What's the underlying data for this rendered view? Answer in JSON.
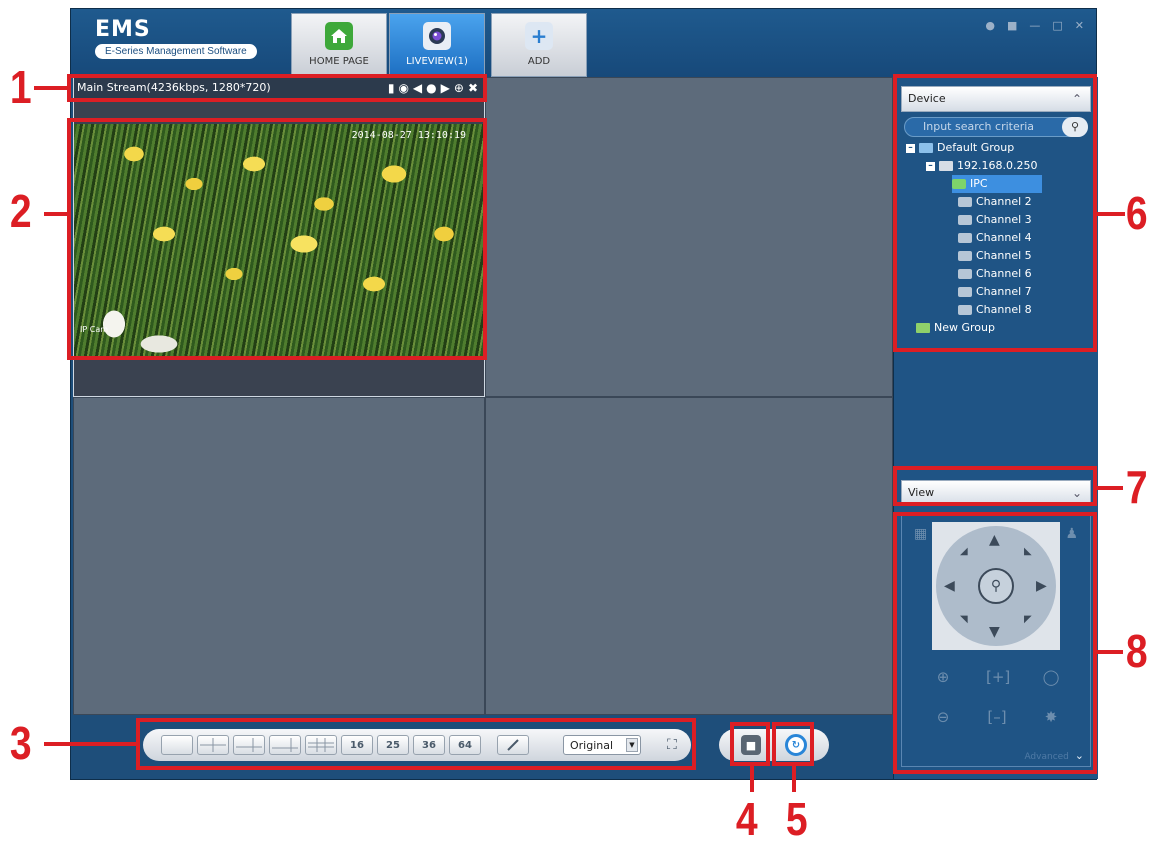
{
  "app": {
    "logo_title": "EMS",
    "logo_subtitle": "E-Series Management Software"
  },
  "tabs": [
    {
      "label": "HOME PAGE",
      "icon": "home-icon"
    },
    {
      "label": "LIVEVIEW(1)",
      "icon": "camera-lens-icon",
      "active": true
    },
    {
      "label": "ADD",
      "icon": "plus-icon"
    }
  ],
  "stream": {
    "info": "Main Stream(4236kbps, 1280*720)",
    "timestamp": "2014-08-27 13:10:19",
    "video_tag": "IP Cam"
  },
  "layout_toolbar": {
    "split_labels": [
      "16",
      "25",
      "36",
      "64"
    ],
    "ratio_value": "Original"
  },
  "panel": {
    "device_header": "Device",
    "search_placeholder": "Input search criteria",
    "tree": {
      "group": "Default Group",
      "device": "192.168.0.250",
      "channels": [
        "IPC",
        "Channel 2",
        "Channel 3",
        "Channel 4",
        "Channel 5",
        "Channel 6",
        "Channel 7",
        "Channel 8"
      ],
      "new_group": "New Group"
    },
    "view_header": "View",
    "ptz_advanced": "Advanced"
  },
  "callouts": [
    "1",
    "2",
    "3",
    "4",
    "5",
    "6",
    "7",
    "8"
  ],
  "colors": {
    "callout": "#dc1e24",
    "frame": "#1e4e7a",
    "active_tab": "#2a86d8",
    "selected_row": "#3d8fe0"
  }
}
